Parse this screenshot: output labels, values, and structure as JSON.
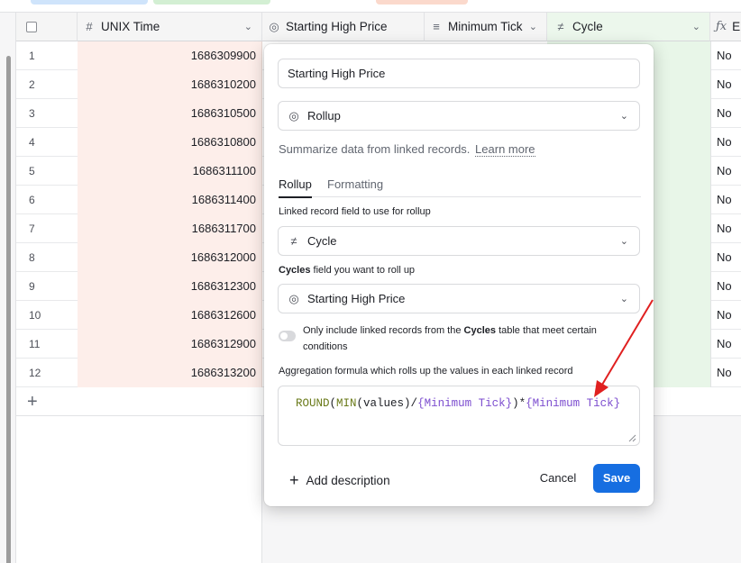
{
  "colors": {
    "accent": "#166ee1",
    "time_column_bg": "#fdeeea",
    "cycle_column_bg": "#e8f6e8",
    "annotation_arrow": "#e02020"
  },
  "columns": {
    "unix_time": {
      "label": "UNIX Time",
      "icon": "number-icon"
    },
    "starting_high": {
      "label": "Starting High Price",
      "icon": "rollup-icon"
    },
    "min_tick": {
      "label": "Minimum Tick",
      "icon": "lookup-icon"
    },
    "cycle": {
      "label": "Cycle",
      "icon": "link-icon"
    },
    "formula_col": {
      "label": "Er",
      "icon": "formula-icon"
    }
  },
  "rows": [
    {
      "num": "1",
      "time": "1686309900",
      "flag": "No"
    },
    {
      "num": "2",
      "time": "1686310200",
      "flag": "No"
    },
    {
      "num": "3",
      "time": "1686310500",
      "flag": "No"
    },
    {
      "num": "4",
      "time": "1686310800",
      "flag": "No"
    },
    {
      "num": "5",
      "time": "1686311100",
      "flag": "No"
    },
    {
      "num": "6",
      "time": "1686311400",
      "flag": "No"
    },
    {
      "num": "7",
      "time": "1686311700",
      "flag": "No"
    },
    {
      "num": "8",
      "time": "1686312000",
      "flag": "No"
    },
    {
      "num": "9",
      "time": "1686312300",
      "flag": "No"
    },
    {
      "num": "10",
      "time": "1686312600",
      "flag": "No"
    },
    {
      "num": "11",
      "time": "1686312900",
      "flag": "No"
    },
    {
      "num": "12",
      "time": "1686313200",
      "flag": "No"
    }
  ],
  "popover": {
    "field_name": "Starting High Price",
    "field_type": "Rollup",
    "help_text": "Summarize data from linked records.",
    "learn_more": "Learn more",
    "tabs": [
      "Rollup",
      "Formatting"
    ],
    "linked_field_label": "Linked record field to use for rollup",
    "linked_field_value": "Cycle",
    "rollup_field_label_bold": "Cycles",
    "rollup_field_label_rest": " field you want to roll up",
    "rollup_field_value": "Starting High Price",
    "condition_text_1": "Only include linked records from the ",
    "condition_text_bold": "Cycles",
    "condition_text_2": " table that meet certain conditions",
    "aggregation_label": "Aggregation formula which rolls up the values in each linked record",
    "formula": {
      "fn1": "ROUND",
      "p1": "(",
      "fn2": "MIN",
      "p2": "(values)/",
      "ref1": "{Minimum Tick}",
      "p3": ")*",
      "ref2": "{Minimum Tick}"
    },
    "add_description": "Add description",
    "cancel": "Cancel",
    "save": "Save"
  }
}
